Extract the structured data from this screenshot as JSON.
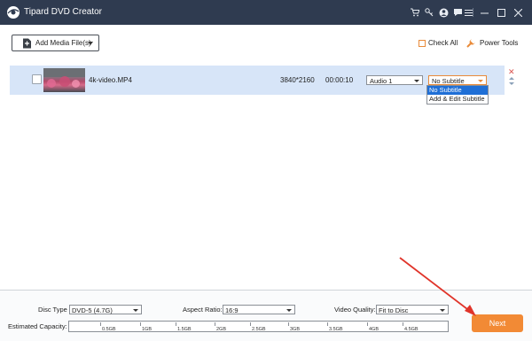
{
  "app": {
    "title": "Tipard DVD Creator",
    "titlebar_icons": [
      "cart-icon",
      "key-icon",
      "user-icon",
      "chat-icon",
      "menu-icon",
      "minimize-icon",
      "maximize-icon",
      "close-icon"
    ]
  },
  "toolbar": {
    "add_media_label": "Add Media File(s)",
    "check_all_label": "Check All",
    "power_tools_label": "Power Tools"
  },
  "media_list": [
    {
      "filename": "4k-video.MP4",
      "resolution": "3840*2160",
      "duration": "00:00:10",
      "audio": "Audio 1",
      "subtitle": "No Subtitle"
    }
  ],
  "subtitle_dropdown": {
    "options": [
      "No Subtitle",
      "Add & Edit Subtitle"
    ],
    "highlighted_index": 0
  },
  "settings": {
    "disc_type_label": "Disc Type",
    "disc_type_value": "DVD-5 (4.7G)",
    "aspect_ratio_label": "Aspect Ratio:",
    "aspect_ratio_value": "16:9",
    "video_quality_label": "Video Quality:",
    "video_quality_value": "Fit to Disc",
    "capacity_label": "Estimated Capacity:",
    "capacity_ticks": [
      "0.5GB",
      "1GB",
      "1.5GB",
      "2GB",
      "2.5GB",
      "3GB",
      "3.5GB",
      "4GB",
      "4.5GB"
    ]
  },
  "next_button_label": "Next",
  "colors": {
    "titlebar": "#2f3b50",
    "accent": "#f28a35",
    "row_highlight": "#d7e5f8",
    "annotation_arrow": "#e0342a"
  }
}
